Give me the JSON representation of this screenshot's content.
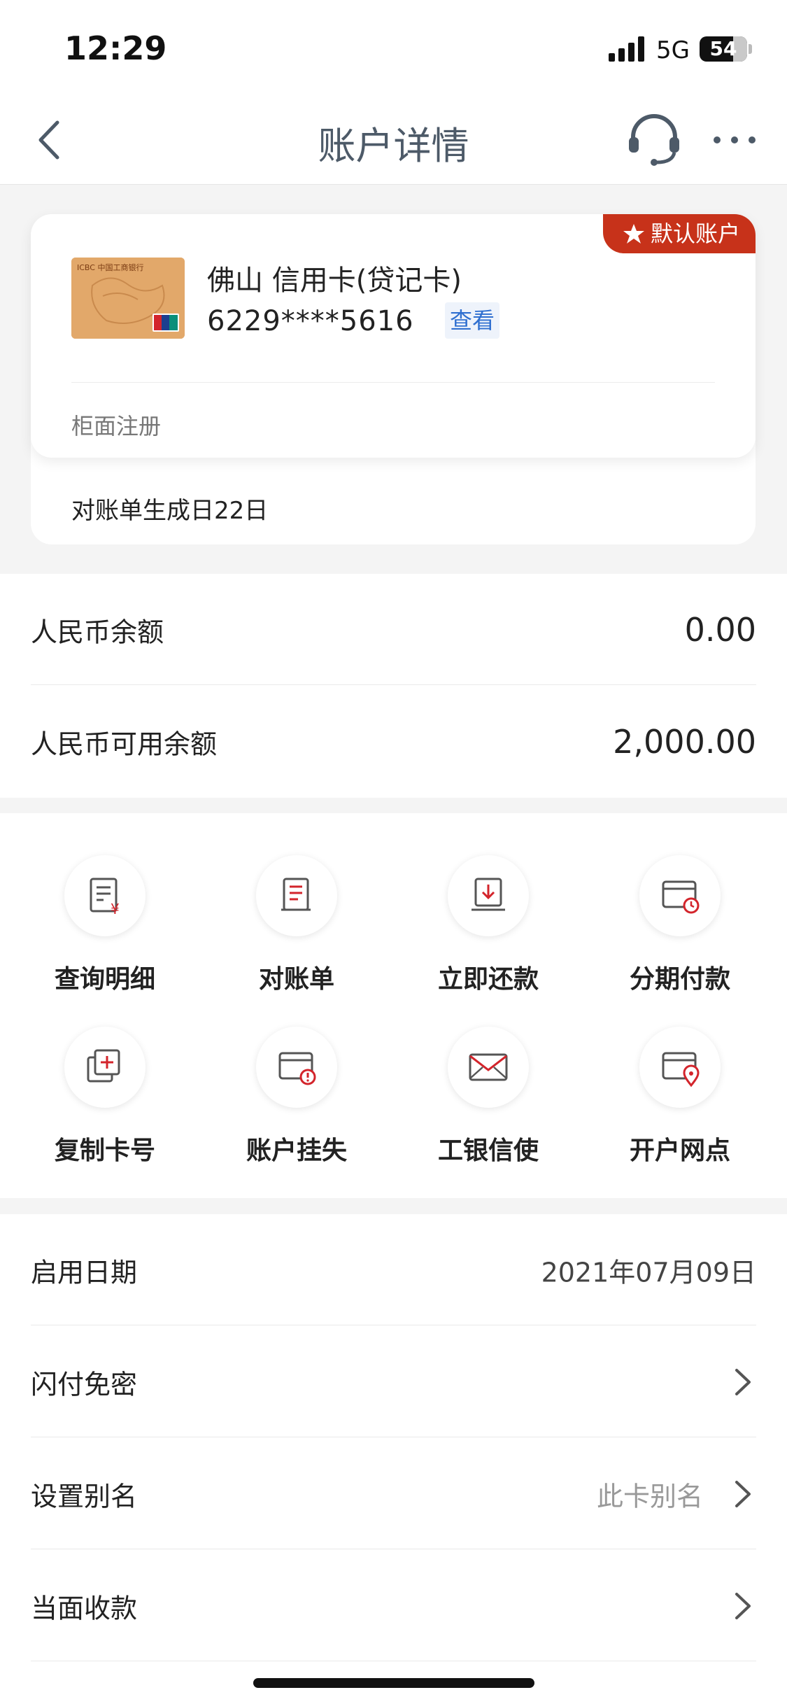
{
  "status_bar": {
    "time": "12:29",
    "network": "5G",
    "battery": "54"
  },
  "nav": {
    "title": "账户详情",
    "back_icon": "chevron-left-icon",
    "support_icon": "headset-icon",
    "more_icon": "more-icon"
  },
  "card": {
    "badge": "默认账户",
    "name": "佛山 信用卡(贷记卡)",
    "number": "6229****5616",
    "view_label": "查看",
    "registration": "柜面注册",
    "statement_day": "对账单生成日22日"
  },
  "balances": [
    {
      "label": "人民币余额",
      "value": "0.00"
    },
    {
      "label": "人民币可用余额",
      "value": "2,000.00"
    }
  ],
  "functions": [
    {
      "label": "查询明细",
      "icon": "bill-detail-icon"
    },
    {
      "label": "对账单",
      "icon": "statement-icon"
    },
    {
      "label": "立即还款",
      "icon": "repay-icon"
    },
    {
      "label": "分期付款",
      "icon": "installment-icon"
    },
    {
      "label": "复制卡号",
      "icon": "copy-icon"
    },
    {
      "label": "账户挂失",
      "icon": "report-loss-icon"
    },
    {
      "label": "工银信使",
      "icon": "mail-icon"
    },
    {
      "label": "开户网点",
      "icon": "branch-location-icon"
    }
  ],
  "list": [
    {
      "label": "启用日期",
      "value": "2021年07月09日"
    },
    {
      "label": "闪付免密"
    },
    {
      "label": "设置别名",
      "hint": "此卡别名"
    },
    {
      "label": "当面收款"
    }
  ],
  "colors": {
    "accent_red": "#c7321a",
    "link_blue": "#2f6fd0",
    "title_gray": "#4d5a68"
  }
}
